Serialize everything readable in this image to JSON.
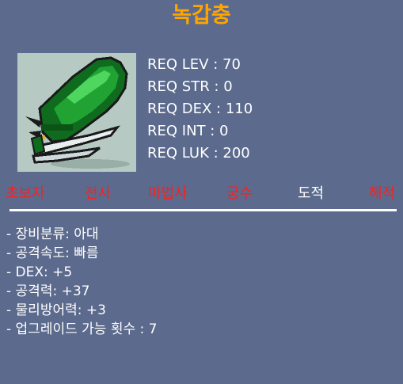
{
  "item": {
    "name": "녹갑충",
    "icon": "green-beetle-claw-icon"
  },
  "requirements": [
    "REQ LEV : 70",
    "REQ STR : 0",
    "REQ DEX : 110",
    "REQ INT : 0",
    "REQ LUK : 200"
  ],
  "jobs": [
    {
      "label": "초보자",
      "enabled": false
    },
    {
      "label": "전사",
      "enabled": false
    },
    {
      "label": "마법사",
      "enabled": false
    },
    {
      "label": "궁수",
      "enabled": false
    },
    {
      "label": "도적",
      "enabled": true
    },
    {
      "label": "해적",
      "enabled": false
    }
  ],
  "options": [
    "- 장비분류: 아대",
    "- 공격속도: 빠름",
    "- DEX: +5",
    "- 공격력: +37",
    "- 물리방어력: +3",
    "- 업그레이드 가능 횟수 : 7"
  ],
  "colors": {
    "background": "#5b6a8d",
    "title": "#ffa500",
    "job_disabled": "#ff1e1e",
    "job_enabled": "#ffffff"
  }
}
